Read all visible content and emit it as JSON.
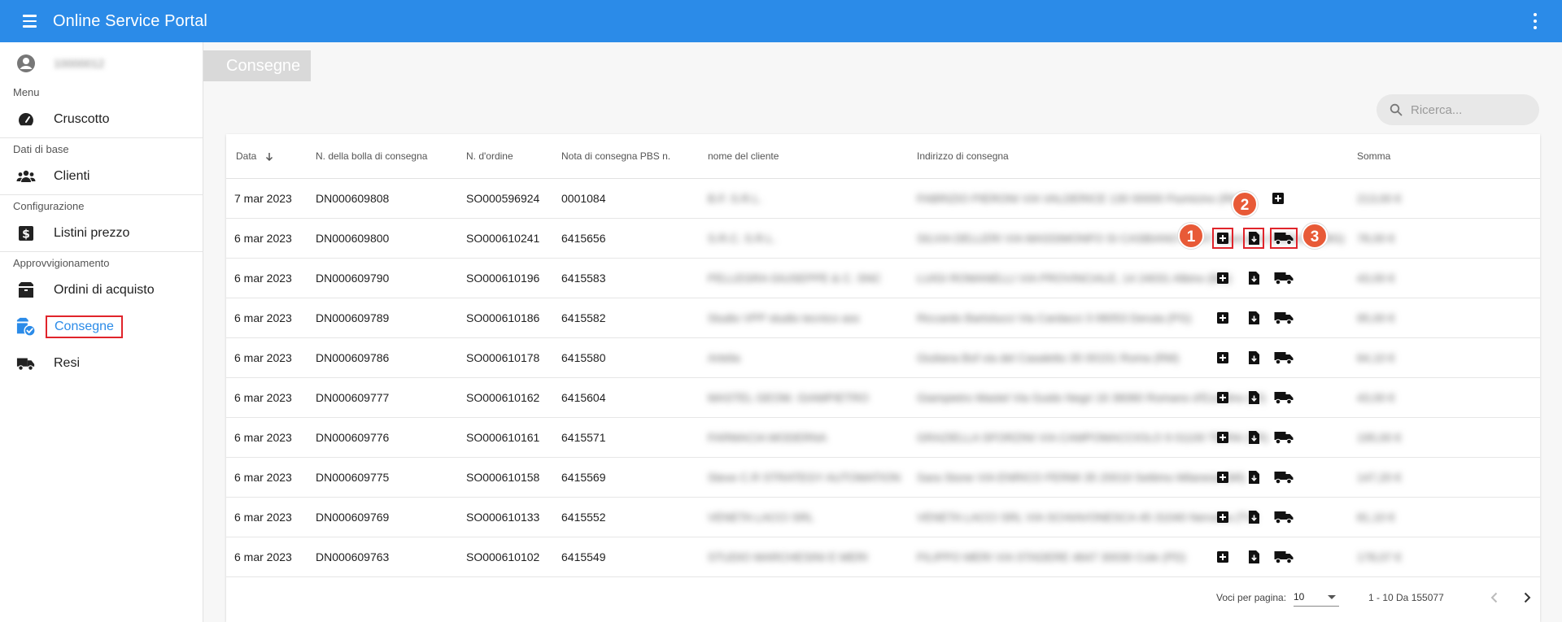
{
  "app": {
    "title": "Online Service Portal"
  },
  "user": {
    "name": "10000012"
  },
  "sidebar": {
    "sections": [
      {
        "label": "Menu",
        "items": [
          {
            "label": "Cruscotto",
            "icon": "speedometer-icon"
          }
        ]
      },
      {
        "label": "Dati di base",
        "items": [
          {
            "label": "Clienti",
            "icon": "people-icon"
          }
        ]
      },
      {
        "label": "Configurazione",
        "items": [
          {
            "label": "Listini prezzo",
            "icon": "dollar-icon"
          }
        ]
      },
      {
        "label": "Approvvigionamento",
        "items": [
          {
            "label": "Ordini di acquisto",
            "icon": "box-icon"
          },
          {
            "label": "Consegne",
            "icon": "delivery-check-icon",
            "active": true
          },
          {
            "label": "Resi",
            "icon": "truck-icon"
          }
        ]
      }
    ]
  },
  "page": {
    "title": "Consegne"
  },
  "search": {
    "placeholder": "Ricerca..."
  },
  "table": {
    "columns": {
      "date": "Data",
      "delivery_note": "N. della bolla di consegna",
      "order": "N. d'ordine",
      "pbs_note": "Nota di consegna PBS n.",
      "customer": "nome del cliente",
      "address": "Indirizzo di consegna",
      "sum": "Somma"
    },
    "rows": [
      {
        "date": "7 mar 2023",
        "delivery_note": "DN000609808",
        "order": "SO000596924",
        "pbs_note": "0001084",
        "customer": "B.F. S.R.L.",
        "address": "FABRIZIO PIERONI VIA VALDERICE 130 00000 Fiumicino (RM)",
        "sum": "213,00 €"
      },
      {
        "date": "6 mar 2023",
        "delivery_note": "DN000609800",
        "order": "SO000610241",
        "pbs_note": "6415656",
        "customer": "S.R.C. S.R.L.",
        "address": "SILVIA DELLERI VIA MASSIMONFO SI CASBIANO 00057 Giancarlo Delfinotto (BG)",
        "sum": "78,00 €"
      },
      {
        "date": "6 mar 2023",
        "delivery_note": "DN000609790",
        "order": "SO000610196",
        "pbs_note": "6415583",
        "customer": "PELLEGRA GIUSEPPE & C. SNC",
        "address": "LUIGI ROMANELLI VIA PROVINCIALE, 14 24031 Albino (BG)",
        "sum": "43,00 €"
      },
      {
        "date": "6 mar 2023",
        "delivery_note": "DN000609789",
        "order": "SO000610186",
        "pbs_note": "6415582",
        "customer": "Studio VPP studio tecnico ass",
        "address": "Riccardo Bartolucci Via Cardacci 3 06053 Deruta (PG)",
        "sum": "95,00 €"
      },
      {
        "date": "6 mar 2023",
        "delivery_note": "DN000609786",
        "order": "SO000610178",
        "pbs_note": "6415580",
        "customer": "Artelia",
        "address": "Giuliana Bof via del Casaletto 35 00151 Roma (RM)",
        "sum": "64,10 €"
      },
      {
        "date": "6 mar 2023",
        "delivery_note": "DN000609777",
        "order": "SO000610162",
        "pbs_note": "6415604",
        "customer": "MASTEL GEOM. GIAMPIETRO",
        "address": "Giampietro Mastel Via Guido Negri 16 36060 Romano d'Ezzelino (VI)",
        "sum": "43,00 €"
      },
      {
        "date": "6 mar 2023",
        "delivery_note": "DN000609776",
        "order": "SO000610161",
        "pbs_note": "6415571",
        "customer": "FARMACIA MODERNA",
        "address": "GRAZIELLA SFORZINI VIA CAMPOMACCIOLO 9 01100 TERNI (TR)",
        "sum": "195,00 €"
      },
      {
        "date": "6 mar 2023",
        "delivery_note": "DN000609775",
        "order": "SO000610158",
        "pbs_note": "6415569",
        "customer": "Steve C.R STRATEGY AUTOMATION",
        "address": "Sara Stone VIA ENRICO FERMI 35 20019 Settimo Milanese (MI)",
        "sum": "147,20 €"
      },
      {
        "date": "6 mar 2023",
        "delivery_note": "DN000609769",
        "order": "SO000610133",
        "pbs_note": "6415552",
        "customer": "VENETA LACCI SRL",
        "address": "VENETA LACCI SRL VIA SCHIAVONESCA 45 31040 Nervesa (TV)",
        "sum": "81,10 €"
      },
      {
        "date": "6 mar 2023",
        "delivery_note": "DN000609763",
        "order": "SO000610102",
        "pbs_note": "6415549",
        "customer": "STUDIO MARCHESINI E MERI",
        "address": "FILIPPO MERI VIA STADERE 4647 30030 Cole (PD)",
        "sum": "178,07 €"
      }
    ]
  },
  "callouts": [
    "1",
    "2",
    "3"
  ],
  "paginator": {
    "per_page_label": "Voci per pagina:",
    "per_page_value": "10",
    "range": "1 - 10 Da 155077"
  },
  "colors": {
    "primary": "#2b8be8",
    "highlight_border": "#e0242b",
    "callout": "#e85a37"
  }
}
